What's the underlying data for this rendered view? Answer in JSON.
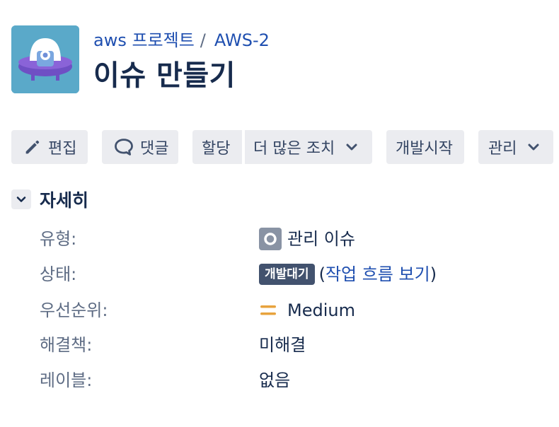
{
  "breadcrumb": {
    "project": "aws 프로젝트",
    "separator": "/",
    "issue_key": "AWS-2"
  },
  "page": {
    "title": "이슈 만들기"
  },
  "toolbar": {
    "edit": "편집",
    "comment": "댓글",
    "assign": "할당",
    "more_actions": "더 많은 조치",
    "start_dev": "개발시작",
    "manage": "관리"
  },
  "details": {
    "title": "자세히",
    "fields": [
      {
        "label": "유형:",
        "value": "관리 이슈"
      },
      {
        "label": "상태:",
        "value": "개발대기",
        "extra_prefix": "(",
        "extra": "작업 흐름 보기",
        "extra_suffix": ")"
      },
      {
        "label": "우선순위:",
        "value": "Medium"
      },
      {
        "label": "해결책:",
        "value": "미해결"
      },
      {
        "label": "레이블:",
        "value": "없음"
      }
    ]
  },
  "colors": {
    "brand_link": "#1f4fb0",
    "button_bg": "#ebecf0",
    "status_lozenge": "#42526e",
    "priority_medium": "#e8a33d",
    "avatar_bg": "#5aa9c9"
  },
  "icons": [
    "project-ufo-avatar-icon",
    "pencil-icon",
    "comment-bubble-icon",
    "chevron-down-icon",
    "issue-type-icon",
    "priority-medium-icon"
  ]
}
